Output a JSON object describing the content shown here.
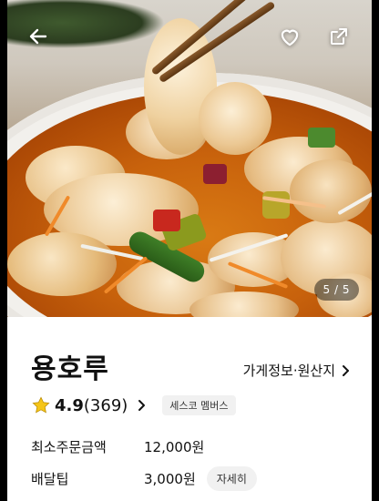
{
  "image": {
    "counter": "5 / 5"
  },
  "restaurant": {
    "name": "용호루",
    "store_info_link": "가게정보·원산지",
    "rating": "4.9",
    "review_count": "(369)",
    "badge": "세스코 멤버스"
  },
  "details": {
    "min_order_label": "최소주문금액",
    "min_order_value": "12,000원",
    "delivery_tip_label": "배달팁",
    "delivery_tip_value": "3,000원",
    "detail_button": "자세히"
  },
  "icons": {
    "back": "back-arrow-icon",
    "favorite": "heart-icon",
    "share": "share-icon",
    "store_chevron": "chevron-right-icon",
    "rating": "star-icon",
    "review_chevron": "chevron-right-icon"
  },
  "colors": {
    "star": "#F5C518",
    "badge_bg": "#F1F1F1"
  }
}
